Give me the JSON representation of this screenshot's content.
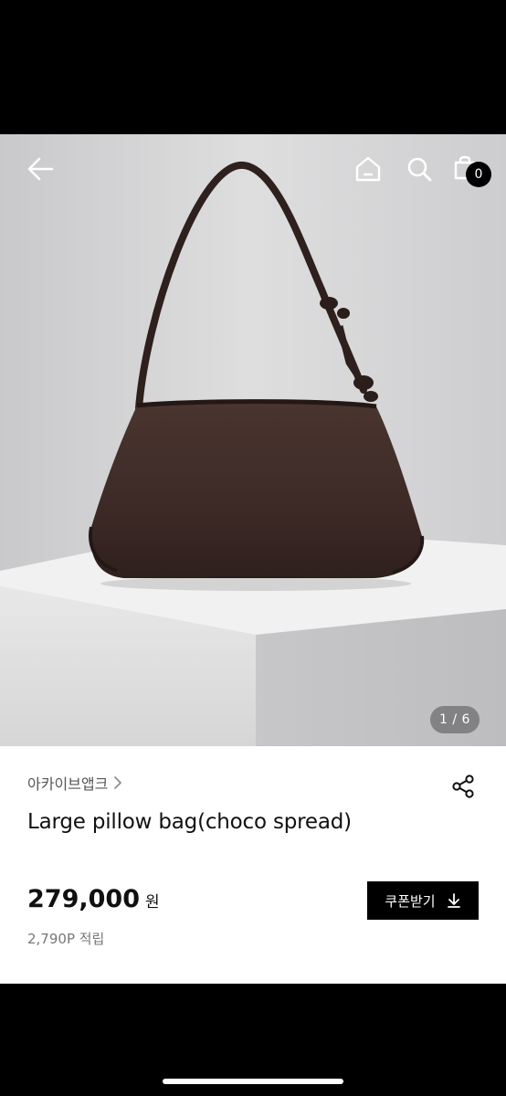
{
  "header": {
    "back_icon": "arrow-left-icon",
    "home_icon": "home-icon",
    "search_icon": "search-icon",
    "cart_icon": "shopping-bag-icon",
    "cart_count": "0"
  },
  "gallery": {
    "pager": "1 / 6",
    "image_subject": "dark brown leather shoulder bag on white pedestal"
  },
  "product": {
    "brand": "아카이브앱크",
    "brand_chevron_icon": "chevron-right-icon",
    "share_icon": "share-icon",
    "title": "Large pillow bag(choco spread)",
    "price": "279,000",
    "currency": "원",
    "points": "2,790P 적립",
    "coupon_label": "쿠폰받기",
    "coupon_icon": "download-icon"
  },
  "colors": {
    "bag": "#3e2b27",
    "accent": "#000000"
  }
}
